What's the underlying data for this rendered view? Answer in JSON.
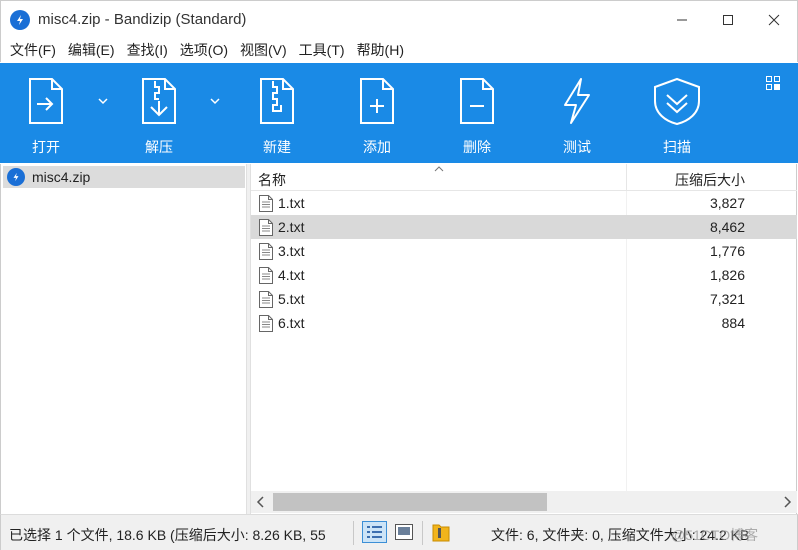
{
  "window": {
    "title": "misc4.zip - Bandizip (Standard)",
    "controls": [
      "minimize",
      "maximize",
      "close"
    ]
  },
  "menu": [
    "文件(F)",
    "编辑(E)",
    "查找(I)",
    "选项(O)",
    "视图(V)",
    "工具(T)",
    "帮助(H)"
  ],
  "toolbar": {
    "open_label": "打开",
    "extract_label": "解压",
    "new_label": "新建",
    "add_label": "添加",
    "delete_label": "删除",
    "test_label": "测试",
    "scan_label": "扫描"
  },
  "tree": {
    "root_label": "misc4.zip"
  },
  "list": {
    "columns": {
      "name": "名称",
      "size": "压缩后大小"
    },
    "rows": [
      {
        "name": "1.txt",
        "size": "3,827",
        "selected": false
      },
      {
        "name": "2.txt",
        "size": "8,462",
        "selected": true
      },
      {
        "name": "3.txt",
        "size": "1,776",
        "selected": false
      },
      {
        "name": "4.txt",
        "size": "1,826",
        "selected": false
      },
      {
        "name": "5.txt",
        "size": "7,321",
        "selected": false
      },
      {
        "name": "6.txt",
        "size": "884",
        "selected": false
      }
    ]
  },
  "status": {
    "left": "已选择 1 个文件, 18.6 KB (压缩后大小: 8.26 KB, 55",
    "right": "文件: 6, 文件夹: 0, 压缩文件大小: 24.2 KB",
    "watermark": "@51CTO博客"
  },
  "colors": {
    "toolbar_bg": "#1a8ae6",
    "selection_bg": "#d9d9d9",
    "brand_blue": "#1a6fd6"
  }
}
